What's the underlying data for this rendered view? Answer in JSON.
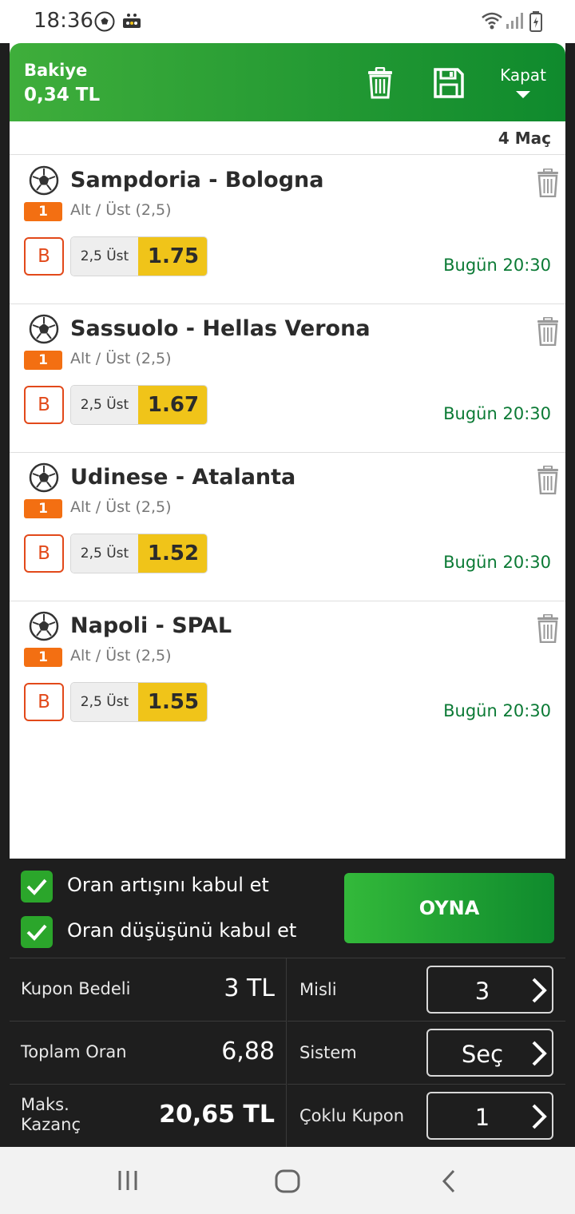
{
  "status_bar": {
    "time": "18:36"
  },
  "header": {
    "balance_label": "Bakiye",
    "balance_value": "0,34 TL",
    "close_label": "Kapat",
    "color_start": "#3fae3b",
    "color_end": "#0f8a2d"
  },
  "match_count": "4 Maç",
  "matches": [
    {
      "title": "Sampdoria - Bologna",
      "badge": "1",
      "market": "Alt / Üst (2,5)",
      "b_label": "B",
      "pick": "2,5 Üst",
      "odds": "1.75",
      "time": "Bugün 20:30"
    },
    {
      "title": "Sassuolo - Hellas Verona",
      "badge": "1",
      "market": "Alt / Üst (2,5)",
      "b_label": "B",
      "pick": "2,5 Üst",
      "odds": "1.67",
      "time": "Bugün 20:30"
    },
    {
      "title": "Udinese - Atalanta",
      "badge": "1",
      "market": "Alt / Üst (2,5)",
      "b_label": "B",
      "pick": "2,5 Üst",
      "odds": "1.52",
      "time": "Bugün 20:30"
    },
    {
      "title": "Napoli - SPAL",
      "badge": "1",
      "market": "Alt / Üst (2,5)",
      "b_label": "B",
      "pick": "2,5 Üst",
      "odds": "1.55",
      "time": "Bugün 20:30"
    }
  ],
  "options": {
    "accept_increase": "Oran artışını kabul et",
    "accept_decrease": "Oran düşüşünü kabul et"
  },
  "play_label": "OYNA",
  "summary": {
    "coupon_amount_label": "Kupon Bedeli",
    "coupon_amount_value": "3 TL",
    "total_odds_label": "Toplam Oran",
    "total_odds_value": "6,88",
    "max_win_label_1": "Maks.",
    "max_win_label_2": "Kazanç",
    "max_win_value": "20,65 TL",
    "multiple_label": "Misli",
    "multiple_value": "3",
    "system_label": "Sistem",
    "system_value": "Seç",
    "multi_coupon_label": "Çoklu Kupon",
    "multi_coupon_value": "1"
  },
  "colors": {
    "accent_green": "#0b7a35",
    "odds_yellow": "#f0c419",
    "badge_orange": "#f36f12",
    "b_button_red": "#e2491a"
  },
  "icons": {
    "trash": "trash-icon",
    "save": "floppy-disk-icon",
    "ball": "soccer-ball-icon",
    "check": "checkmark-icon",
    "chevron": "chevron-right-icon"
  }
}
